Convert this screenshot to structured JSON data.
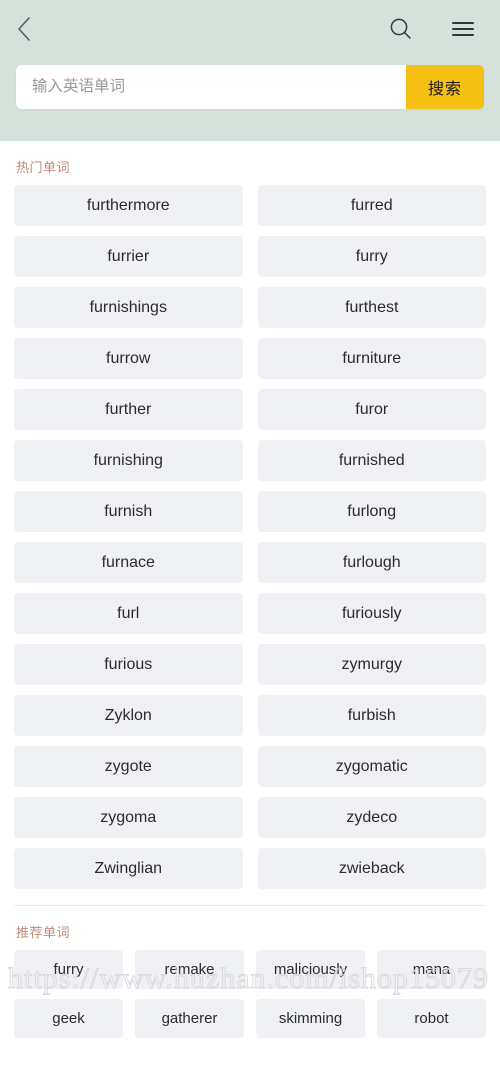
{
  "header": {
    "background_color": "#d5e2dc",
    "back_icon": "chevron-left-icon",
    "search_icon": "search-icon",
    "menu_icon": "hamburger-menu-icon",
    "search": {
      "value": "",
      "placeholder": "输入英语单词",
      "button_label": "搜索",
      "button_color": "#f4c013"
    }
  },
  "sections": {
    "hot": {
      "title": "热门单词",
      "title_color": "#c08a78",
      "words": [
        "furthermore",
        "furred",
        "furrier",
        "furry",
        "furnishings",
        "furthest",
        "furrow",
        "furniture",
        "further",
        "furor",
        "furnishing",
        "furnished",
        "furnish",
        "furlong",
        "furnace",
        "furlough",
        "furl",
        "furiously",
        "furious",
        "zymurgy",
        "Zyklon",
        "furbish",
        "zygote",
        "zygomatic",
        "zygoma",
        "zydeco",
        "Zwinglian",
        "zwieback"
      ]
    },
    "recommended": {
      "title": "推荐单词",
      "title_color": "#c08a78",
      "words": [
        "furry",
        "remake",
        "maliciously",
        "mana",
        "geek",
        "gatherer",
        "skimming",
        "robot"
      ]
    }
  },
  "watermark": {
    "text": "https://www.huzhan.com/ishop15079"
  }
}
